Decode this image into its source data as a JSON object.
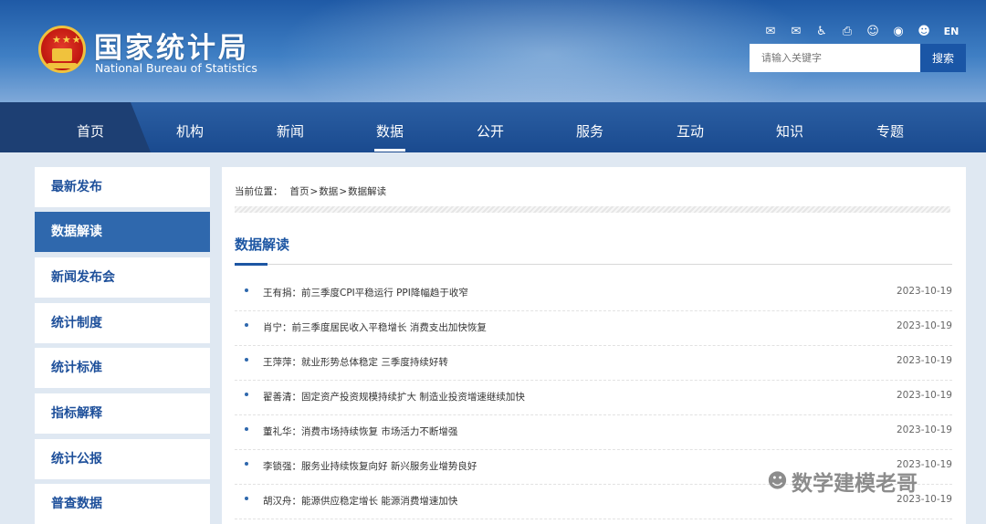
{
  "header": {
    "title_cn": "国家统计局",
    "title_en": "National Bureau of Statistics",
    "tools": [
      {
        "icon": "mail-icon",
        "glyph": "✉"
      },
      {
        "icon": "mail-settings-icon",
        "glyph": "✉"
      },
      {
        "icon": "accessibility-icon",
        "glyph": "♿"
      },
      {
        "icon": "print-icon",
        "glyph": "⎙"
      },
      {
        "icon": "robot-icon",
        "glyph": "☺"
      },
      {
        "icon": "weibo-icon",
        "glyph": "◉"
      },
      {
        "icon": "wechat-icon",
        "glyph": "☻"
      }
    ],
    "lang_label": "EN",
    "search": {
      "placeholder": "请输入关键字",
      "button": "搜索"
    }
  },
  "nav": {
    "items": [
      "首页",
      "机构",
      "新闻",
      "数据",
      "公开",
      "服务",
      "互动",
      "知识",
      "专题"
    ],
    "active": "数据"
  },
  "sidebar": {
    "items": [
      "最新发布",
      "数据解读",
      "新闻发布会",
      "统计制度",
      "统计标准",
      "指标解释",
      "统计公报",
      "普查数据"
    ],
    "active": "数据解读"
  },
  "breadcrumb": {
    "label": "当前位置：",
    "path": [
      "首页",
      "数据",
      "数据解读"
    ],
    "sep": ">"
  },
  "section_title": "数据解读",
  "articles": [
    {
      "title": "王有捐：前三季度CPI平稳运行 PPI降幅趋于收窄",
      "date": "2023-10-19"
    },
    {
      "title": "肖宁：前三季度居民收入平稳增长 消费支出加快恢复",
      "date": "2023-10-19"
    },
    {
      "title": "王萍萍：就业形势总体稳定 三季度持续好转",
      "date": "2023-10-19"
    },
    {
      "title": "翟善清：固定资产投资规模持续扩大 制造业投资增速继续加快",
      "date": "2023-10-19"
    },
    {
      "title": "董礼华：消费市场持续恢复 市场活力不断增强",
      "date": "2023-10-19"
    },
    {
      "title": "李锁强：服务业持续恢复向好 新兴服务业增势良好",
      "date": "2023-10-19"
    },
    {
      "title": "胡汉舟：能源供应稳定增长 能源消费增速加快",
      "date": "2023-10-19"
    }
  ],
  "watermark": "数学建模老哥"
}
